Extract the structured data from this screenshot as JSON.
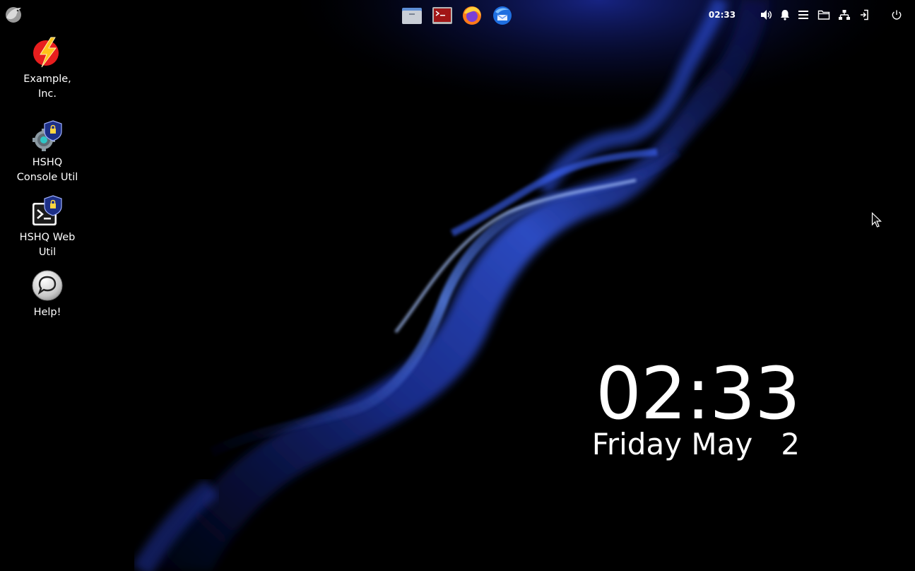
{
  "panel": {
    "clock": "02:33",
    "launchers": [
      {
        "name": "files",
        "icon": "file-manager-icon"
      },
      {
        "name": "terminal",
        "icon": "terminal-icon"
      },
      {
        "name": "firefox",
        "icon": "firefox-icon"
      },
      {
        "name": "thunderbird",
        "icon": "thunderbird-icon"
      }
    ],
    "tray": [
      "volume-icon",
      "bell-icon",
      "hamburger-menu-icon",
      "folder-icon",
      "network-icon",
      "logout-icon",
      "power-icon"
    ]
  },
  "desktop_icons": [
    {
      "label": "Example,\nInc.",
      "icon": "lightning-bolt-icon"
    },
    {
      "label": "HSHQ\nConsole Util",
      "icon": "gear-shield-icon"
    },
    {
      "label": "HSHQ Web\nUtil",
      "icon": "terminal-shield-icon"
    },
    {
      "label": "Help!",
      "icon": "speech-bubble-icon"
    }
  ],
  "clock_widget": {
    "time": "02:33",
    "date": "Friday May   2"
  },
  "colors": {
    "background": "#000000",
    "wave_blue": "#2b4bd6",
    "wave_highlight": "#7fa8ff",
    "text": "#ffffff"
  }
}
